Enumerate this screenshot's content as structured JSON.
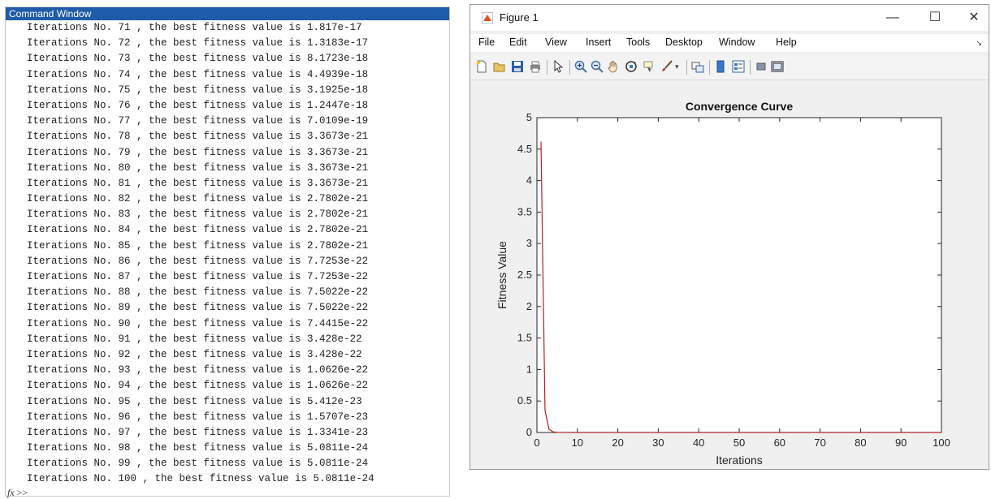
{
  "command_window": {
    "title": "Command Window",
    "lines": [
      "Iterations No. 71 , the best fitness value is 1.817e-17",
      "Iterations No. 72 , the best fitness value is 1.3183e-17",
      "Iterations No. 73 , the best fitness value is 8.1723e-18",
      "Iterations No. 74 , the best fitness value is 4.4939e-18",
      "Iterations No. 75 , the best fitness value is 3.1925e-18",
      "Iterations No. 76 , the best fitness value is 1.2447e-18",
      "Iterations No. 77 , the best fitness value is 7.0109e-19",
      "Iterations No. 78 , the best fitness value is 3.3673e-21",
      "Iterations No. 79 , the best fitness value is 3.3673e-21",
      "Iterations No. 80 , the best fitness value is 3.3673e-21",
      "Iterations No. 81 , the best fitness value is 3.3673e-21",
      "Iterations No. 82 , the best fitness value is 2.7802e-21",
      "Iterations No. 83 , the best fitness value is 2.7802e-21",
      "Iterations No. 84 , the best fitness value is 2.7802e-21",
      "Iterations No. 85 , the best fitness value is 2.7802e-21",
      "Iterations No. 86 , the best fitness value is 7.7253e-22",
      "Iterations No. 87 , the best fitness value is 7.7253e-22",
      "Iterations No. 88 , the best fitness value is 7.5022e-22",
      "Iterations No. 89 , the best fitness value is 7.5022e-22",
      "Iterations No. 90 , the best fitness value is 7.4415e-22",
      "Iterations No. 91 , the best fitness value is 3.428e-22",
      "Iterations No. 92 , the best fitness value is 3.428e-22",
      "Iterations No. 93 , the best fitness value is 1.0626e-22",
      "Iterations No. 94 , the best fitness value is 1.0626e-22",
      "Iterations No. 95 , the best fitness value is 5.412e-23",
      "Iterations No. 96 , the best fitness value is 1.5707e-23",
      "Iterations No. 97 , the best fitness value is 1.3341e-23",
      "Iterations No. 98 , the best fitness value is 5.0811e-24",
      "Iterations No. 99 , the best fitness value is 5.0811e-24",
      "Iterations No. 100 , the best fitness value is 5.0811e-24"
    ],
    "prompt_fx": "fx",
    "prompt": ">>"
  },
  "figure_window": {
    "title": "Figure 1",
    "controls": {
      "minimize": "—",
      "maximize": "☐",
      "close": "✕"
    },
    "menu": [
      "File",
      "Edit",
      "View",
      "Insert",
      "Tools",
      "Desktop",
      "Window",
      "Help"
    ],
    "toolbar_icons": [
      "new-figure-icon",
      "open-file-icon",
      "save-icon",
      "print-icon",
      "pointer-icon",
      "zoom-in-icon",
      "zoom-out-icon",
      "pan-icon",
      "rotate-icon",
      "data-cursor-icon",
      "brush-icon",
      "link-plot-icon",
      "colorbar-icon",
      "legend-icon",
      "hide-plot-tools-icon",
      "show-plot-tools-icon"
    ],
    "colors": {
      "titlebar_icon": "#d9541a",
      "line": "#b22222"
    }
  },
  "chart_data": {
    "type": "line",
    "title": "Convergence Curve",
    "xlabel": "Iterations",
    "ylabel": "Fitness Value",
    "xlim": [
      0,
      100
    ],
    "ylim": [
      0,
      5
    ],
    "xticks": [
      0,
      10,
      20,
      30,
      40,
      50,
      60,
      70,
      80,
      90,
      100
    ],
    "yticks": [
      0,
      0.5,
      1,
      1.5,
      2,
      2.5,
      3,
      3.5,
      4,
      4.5,
      5
    ],
    "grid": false,
    "series": [
      {
        "x": [
          1,
          2,
          3,
          4,
          5,
          10,
          20,
          30,
          40,
          50,
          60,
          70,
          80,
          90,
          100
        ],
        "values": [
          4.62,
          0.35,
          0.05,
          0.01,
          0.002,
          0.0001,
          1e-08,
          1e-10,
          1e-12,
          1e-14,
          1e-15,
          1e-17,
          3.3673e-21,
          7.4415e-22,
          5.0811e-24
        ]
      }
    ]
  }
}
